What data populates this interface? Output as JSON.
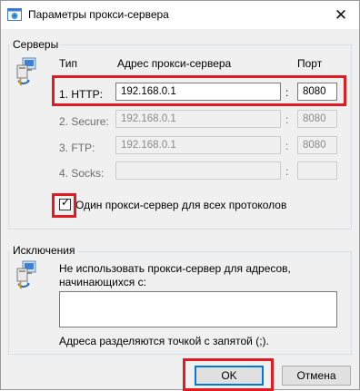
{
  "window": {
    "title": "Параметры прокси-сервера",
    "close_glyph": "✕"
  },
  "servers": {
    "group_label": "Серверы",
    "header_type": "Тип",
    "header_address": "Адрес прокси-сервера",
    "header_port": "Порт",
    "rows": [
      {
        "label": "1. HTTP:",
        "address": "192.168.0.1",
        "port": "8080",
        "enabled": true
      },
      {
        "label": "2. Secure:",
        "address": "192.168.0.1",
        "port": "8080",
        "enabled": false
      },
      {
        "label": "3. FTP:",
        "address": "192.168.0.1",
        "port": "8080",
        "enabled": false
      },
      {
        "label": "4. Socks:",
        "address": "",
        "port": "",
        "enabled": false
      }
    ],
    "colon": ":",
    "same_proxy_label": "Один прокси-сервер для всех протоколов",
    "same_proxy_checked": true
  },
  "exceptions": {
    "group_label": "Исключения",
    "description": "Не использовать прокси-сервер для адресов, начинающихся с:",
    "value": "",
    "hint": "Адреса разделяются точкой с запятой (;)."
  },
  "buttons": {
    "ok": "OK",
    "cancel": "Отмена"
  },
  "colors": {
    "highlight": "#e11b22",
    "accent": "#0078d7",
    "window_bg": "#f0f0f0"
  },
  "icons": [
    "app-globe-icon",
    "close-icon",
    "network-computer-icon",
    "checkmark-icon"
  ]
}
